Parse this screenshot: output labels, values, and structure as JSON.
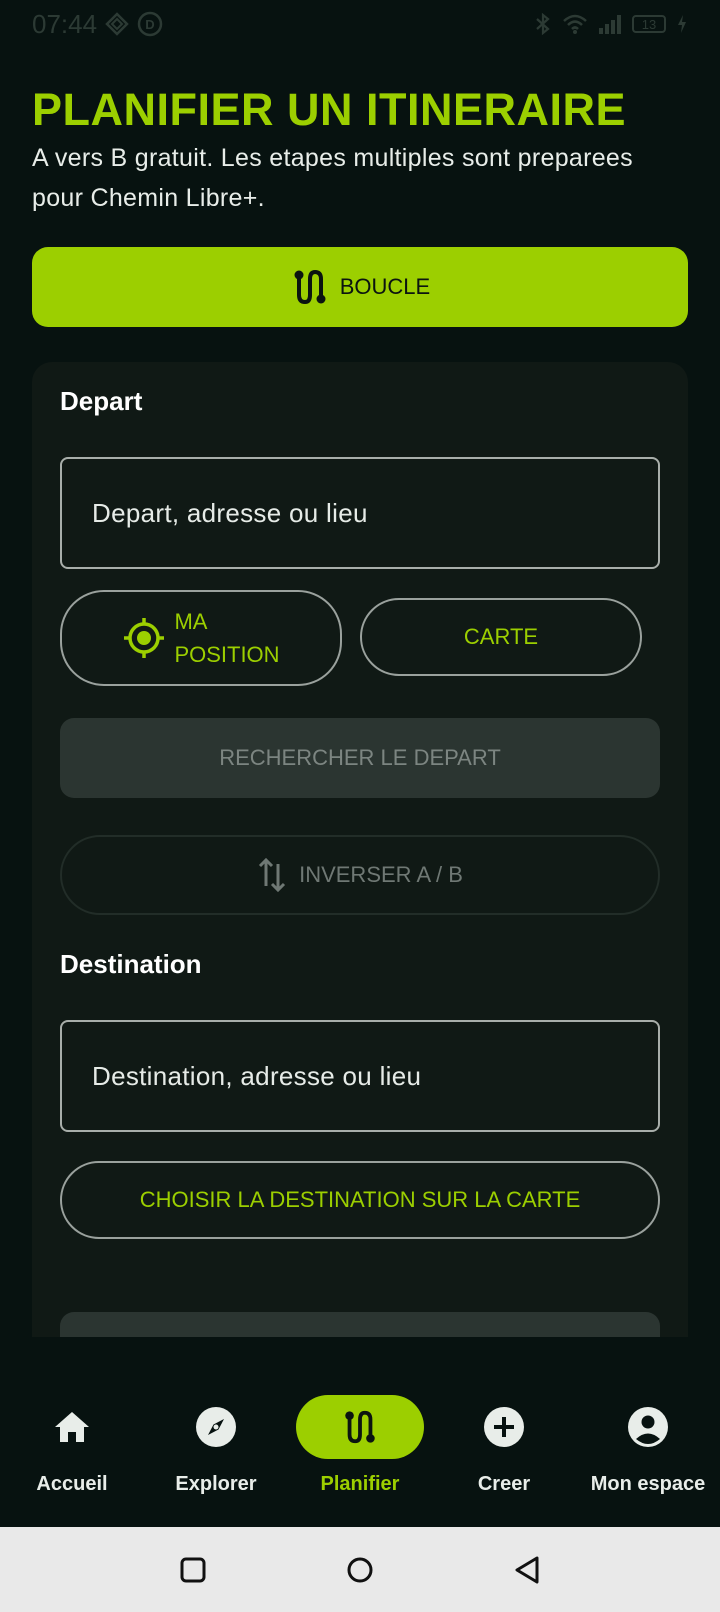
{
  "status_bar": {
    "time": "07:44",
    "battery": "13"
  },
  "header": {
    "title": "PLANIFIER UN ITINERAIRE",
    "subtitle": "A vers B gratuit. Les etapes multiples sont preparees pour Chemin Libre+."
  },
  "loop_button": {
    "label": "BOUCLE"
  },
  "departure": {
    "label": "Depart",
    "placeholder": "Depart, adresse ou lieu",
    "my_position_line1": "MA",
    "my_position_line2": "POSITION",
    "map_label": "CARTE",
    "search_label": "RECHERCHER LE DEPART",
    "swap_label": "INVERSER A / B"
  },
  "destination": {
    "label": "Destination",
    "placeholder": "Destination, adresse ou lieu",
    "map_label": "CHOISIR LA DESTINATION SUR LA CARTE"
  },
  "bottom_nav": {
    "items": [
      {
        "label": "Accueil",
        "icon": "home-icon"
      },
      {
        "label": "Explorer",
        "icon": "compass-icon"
      },
      {
        "label": "Planifier",
        "icon": "route-icon",
        "active": true
      },
      {
        "label": "Creer",
        "icon": "plus-circle-icon"
      },
      {
        "label": "Mon espace",
        "icon": "account-icon"
      }
    ]
  },
  "colors": {
    "accent": "#9ccf00",
    "background": "#071210",
    "card": "#101915"
  }
}
